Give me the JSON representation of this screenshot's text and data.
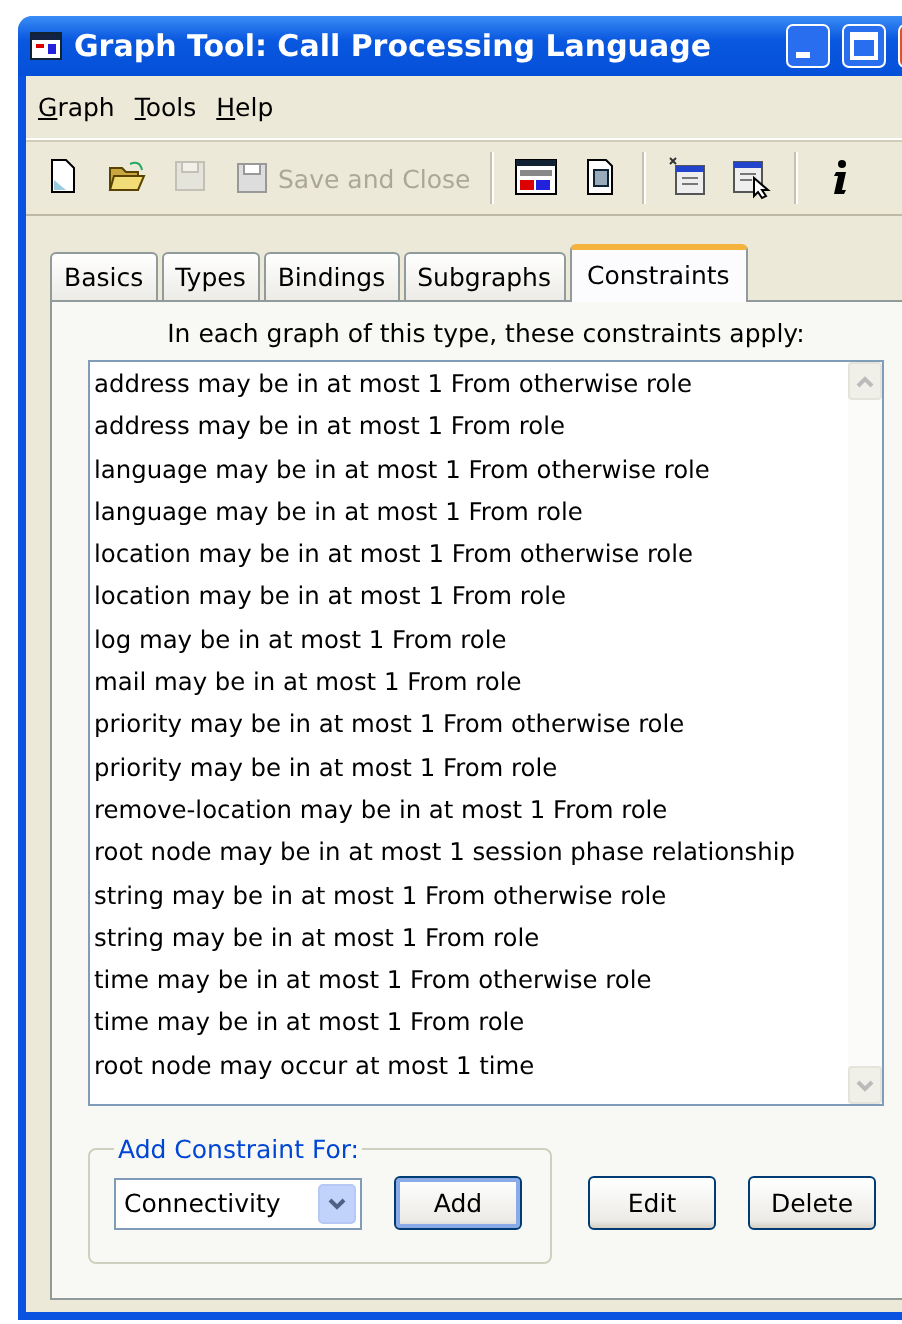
{
  "window": {
    "title": "Graph Tool: Call Processing Language"
  },
  "menu": [
    {
      "label": "Graph"
    },
    {
      "label": "Tools"
    },
    {
      "label": "Help"
    }
  ],
  "toolbar": [
    {
      "kind": "new",
      "disabled": false
    },
    {
      "kind": "open",
      "disabled": false
    },
    {
      "kind": "save",
      "disabled": true
    },
    {
      "kind": "save-close",
      "label": "Save and Close",
      "disabled": true
    },
    {
      "kind": "separator"
    },
    {
      "kind": "merl",
      "disabled": false
    },
    {
      "kind": "id",
      "disabled": false
    },
    {
      "kind": "separator"
    },
    {
      "kind": "new-window",
      "disabled": false
    },
    {
      "kind": "select-window",
      "disabled": false
    },
    {
      "kind": "separator"
    },
    {
      "kind": "info",
      "disabled": false
    }
  ],
  "tabs": [
    {
      "label": "Basics",
      "selected": false
    },
    {
      "label": "Types",
      "selected": false
    },
    {
      "label": "Bindings",
      "selected": false
    },
    {
      "label": "Subgraphs",
      "selected": false
    },
    {
      "label": "Constraints",
      "selected": true
    }
  ],
  "heading": "In each graph of this type, these constraints apply:",
  "constraints": [
    "address may be in at most 1 From otherwise role",
    "address may be in at most 1 From role",
    "language may be in at most 1 From otherwise role",
    "language may be in at most 1 From role",
    "location may be in at most 1 From otherwise role",
    "location may be in at most 1 From role",
    "log may be in at most 1 From role",
    "mail may be in at most 1 From role",
    "priority may be in at most 1 From otherwise role",
    "priority may be in at most 1 From role",
    "remove-location may be in at most 1 From role",
    "root node may be in at most 1 session phase relationship",
    "string may be in at most 1 From otherwise role",
    "string may be in at most 1 From role",
    "time may be in at most 1 From otherwise role",
    "time may be in at most 1 From role",
    "root node may occur at most 1 time"
  ],
  "add_group": {
    "title": "Add Constraint For:",
    "dropdown": {
      "value": "Connectivity"
    },
    "button": "Add"
  },
  "buttons": [
    "Edit",
    "Delete"
  ]
}
